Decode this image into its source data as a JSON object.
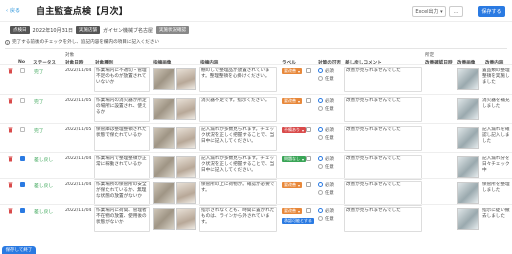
{
  "header": {
    "back_label": "戻る",
    "title": "自主監査点検【月次】",
    "excel_label": "Excel出力",
    "more_label": "…",
    "save_label": "保存する"
  },
  "meta": {
    "date_label": "点検日",
    "date_value": "2022年10月31日",
    "store_label": "実施店舗",
    "store_value": "ガイセン機械ブ名古屋",
    "tag": "実施状況確認"
  },
  "notice": "完了する前後のチェックを外し、追記内容を欄内の項目に記入ください",
  "columns": {
    "group1": "対象",
    "group2": "所定",
    "no": "No",
    "status": "ステータス",
    "date": "対象日時",
    "content": "対象種別",
    "photo": "指摘画像",
    "detail": "指摘内容",
    "label": "ラベル",
    "check": "対策の可否",
    "comment": "差し戻しコメント",
    "reply_date": "改善確認日時",
    "reply_photo": "改善画像",
    "reply_detail": "改善内容"
  },
  "rows": [
    {
      "status": "完了",
      "date": "2022/11/04",
      "content": "作業場内に不適切・管理不足のものが放置されていないか",
      "detail": "棚のしで整理品が放置されています。整理整頓を心掛けください。",
      "label": "要改善",
      "label_color": "#e8883a",
      "checked": false,
      "opt1": "必須",
      "opt2": "任意",
      "comment": "改善が見られませんでした",
      "r_detail": "置品類の整理整頓を実施しました"
    },
    {
      "status": "完了",
      "date": "2022/11/05",
      "content": "作業場内の消火器が所定の場所に設置され、使えるか",
      "detail": "消火器不足です。指示ください。",
      "label": "要改善",
      "label_color": "#e8883a",
      "checked": false,
      "opt1": "必須",
      "opt2": "任意",
      "comment": "改善が見られませんでした",
      "r_detail": "消火器を補充しました"
    },
    {
      "status": "完了",
      "date": "2022/11/05",
      "content": "保管庫は整理整頓された状態で保たれているか",
      "detail": "記入漏れが多数見られます。チェック状況を正しく把握することで、当日中に記入してください。",
      "label": "不備あり",
      "label_color": "#d94b4b",
      "checked": false,
      "opt1": "必須",
      "opt2": "任意",
      "comment": "改善が見られませんでした",
      "r_detail": "記入漏れを確認し記入しました"
    },
    {
      "status": "差し戻し",
      "date": "2022/11/04",
      "content": "作業場内で整理整頓が正常に稼動されているか",
      "detail": "記入漏れが多数見られます。チェック状況を正しく把握することで、当日中に記入してください。",
      "label": "問題なし",
      "label_color": "#3aa557",
      "checked": true,
      "opt1": "必須",
      "opt2": "任意",
      "comment": "改善が見られませんでした",
      "r_detail": "記入漏れ分を日々チェック中"
    },
    {
      "status": "差し戻し",
      "date": "2022/11/04",
      "content": "作業場所の保管所の安全が保たれているか、無理な状態の放置がないか",
      "detail": "保管所の上に荷物が。確認が必要です。",
      "label": "要改善",
      "label_color": "#e8883a",
      "checked": true,
      "opt1": "必須",
      "opt2": "任意",
      "comment": "改善が見られませんでした",
      "r_detail": "保管所を整理しました"
    },
    {
      "status": "差し戻し",
      "date": "2022/11/04",
      "content": "作業場内に荷間、管理者不在物の放置、使用後の状態がないか",
      "detail": "指示されなくとも、時間に置かれたものは、ラインから外されています。",
      "label": "要改善",
      "label_color": "#e8883a",
      "checked": true,
      "opt1": "必須",
      "opt2": "任意",
      "comment": "改善が見られませんでした",
      "r_detail": "指示に従い撤去しました",
      "extra_tag": "承認可能とする"
    }
  ],
  "footer": {
    "bottom_label": "保存して終了"
  }
}
